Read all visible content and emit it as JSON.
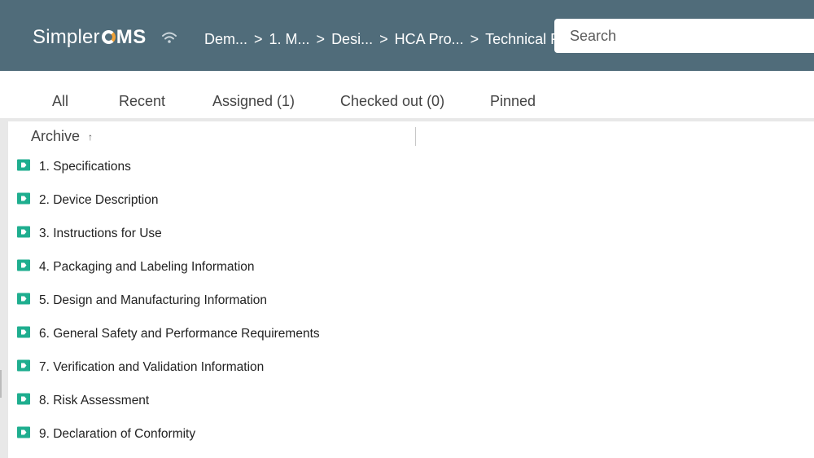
{
  "header": {
    "logo_part1": "Simpler",
    "logo_part2": "MS",
    "breadcrumb": [
      "Dem...",
      "1. M...",
      "Desi...",
      "HCA Pro...",
      "Technical File"
    ],
    "breadcrumb_separator": ">",
    "search_placeholder": "Search"
  },
  "tabs": [
    "All",
    "Recent",
    "Assigned (1)",
    "Checked out (0)",
    "Pinned"
  ],
  "list": {
    "column_header": "Archive",
    "sort_indicator": "↑",
    "items": [
      "1. Specifications",
      "2. Device Description",
      "3. Instructions for Use",
      "4. Packaging and Labeling Information",
      "5. Design and Manufacturing Information",
      "6. General Safety and Performance Requirements",
      "7. Verification and Validation Information",
      "8. Risk Assessment",
      "9. Declaration of Conformity"
    ]
  },
  "colors": {
    "header_bg": "#506c7a",
    "folder_green": "#1fae8f",
    "logo_accent": "#f2a236"
  },
  "icons": {
    "connection": "wifi-icon",
    "folder": "folder-icon",
    "sort": "sort-ascending-icon"
  }
}
